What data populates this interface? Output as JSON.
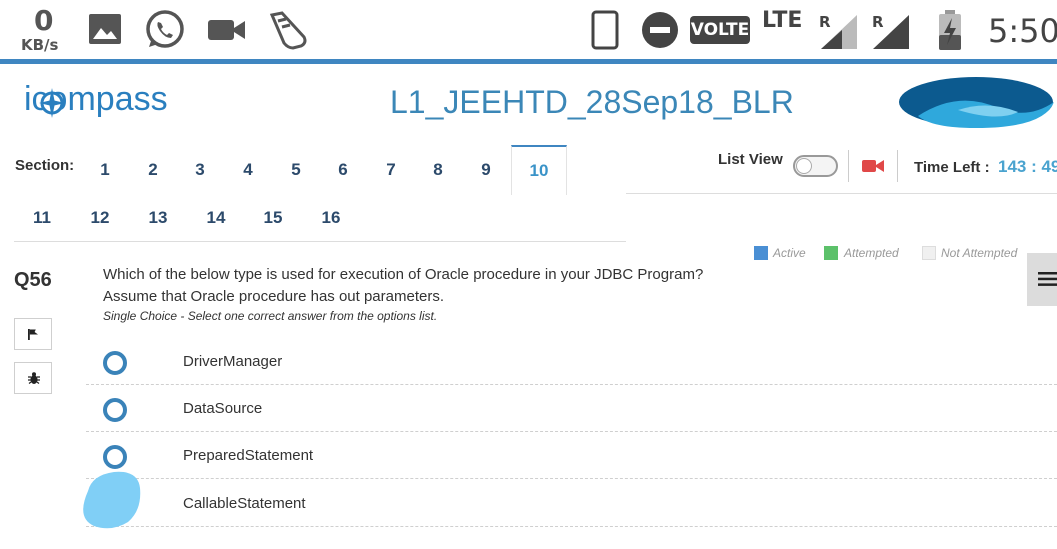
{
  "statusbar": {
    "net_speed_value": "0",
    "net_speed_unit": "KB/s",
    "volte": "VOLTE",
    "lte": "LTE",
    "roaming_1": "R",
    "roaming_2": "R",
    "clock": "5:50",
    "accent_color": "#3f86c1"
  },
  "header": {
    "logo_text": "icompass",
    "test_title": "L1_JEEHTD_28Sep18_BLR"
  },
  "sections": {
    "label": "Section:",
    "items": [
      "1",
      "2",
      "3",
      "4",
      "5",
      "6",
      "7",
      "8",
      "9",
      "10",
      "11",
      "12",
      "13",
      "14",
      "15",
      "16"
    ],
    "active": "10"
  },
  "controls": {
    "list_view_label": "List View",
    "list_view_on": false,
    "time_left_label": "Time Left :",
    "time_left_value": "143 : 49"
  },
  "legend": {
    "active": "Active",
    "attempted": "Attempted",
    "not_attempted": "Not Attempted",
    "active_color": "#4a8fd4",
    "attempted_color": "#5cc16a",
    "not_attempted_color": "#f0f0f0"
  },
  "question": {
    "number": "Q56",
    "text_line1": "Which of the below type is used for execution of Oracle procedure in your JDBC Program?",
    "text_line2": "Assume that Oracle procedure has out parameters.",
    "type": "Single Choice - Select one correct answer from the options list.",
    "options": [
      "DriverManager",
      "DataSource",
      "PreparedStatement",
      "CallableStatement"
    ]
  },
  "icons": {
    "flag": "flag-icon",
    "bug": "bug-icon",
    "menu": "hamburger-menu-icon",
    "camera": "video-camera-icon"
  }
}
